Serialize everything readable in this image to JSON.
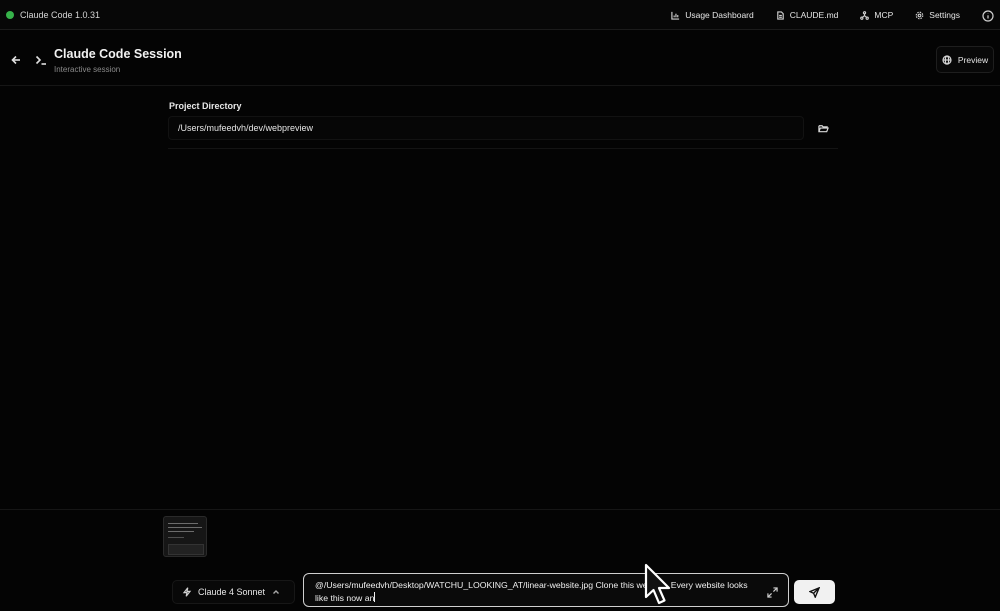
{
  "app": {
    "title": "Claude Code 1.0.31",
    "status_color": "#36b24a"
  },
  "topnav": {
    "items": [
      {
        "label": "Usage Dashboard",
        "icon": "bar-chart-icon"
      },
      {
        "label": "CLAUDE.md",
        "icon": "file-icon"
      },
      {
        "label": "MCP",
        "icon": "network-icon"
      },
      {
        "label": "Settings",
        "icon": "gear-icon"
      }
    ],
    "info_icon": "info-icon"
  },
  "session": {
    "title": "Claude Code Session",
    "subtitle": "Interactive session",
    "preview_label": "Preview"
  },
  "project": {
    "label": "Project Directory",
    "path": "/Users/mufeedvh/dev/webpreview"
  },
  "composer": {
    "model": "Claude 4 Sonnet",
    "prompt": "@/Users/mufeedvh/Desktop/WATCHU_LOOKING_AT/linear-website.jpg Clone this website. Every website looks like this now an",
    "accent_color": "#f1f1f1"
  }
}
